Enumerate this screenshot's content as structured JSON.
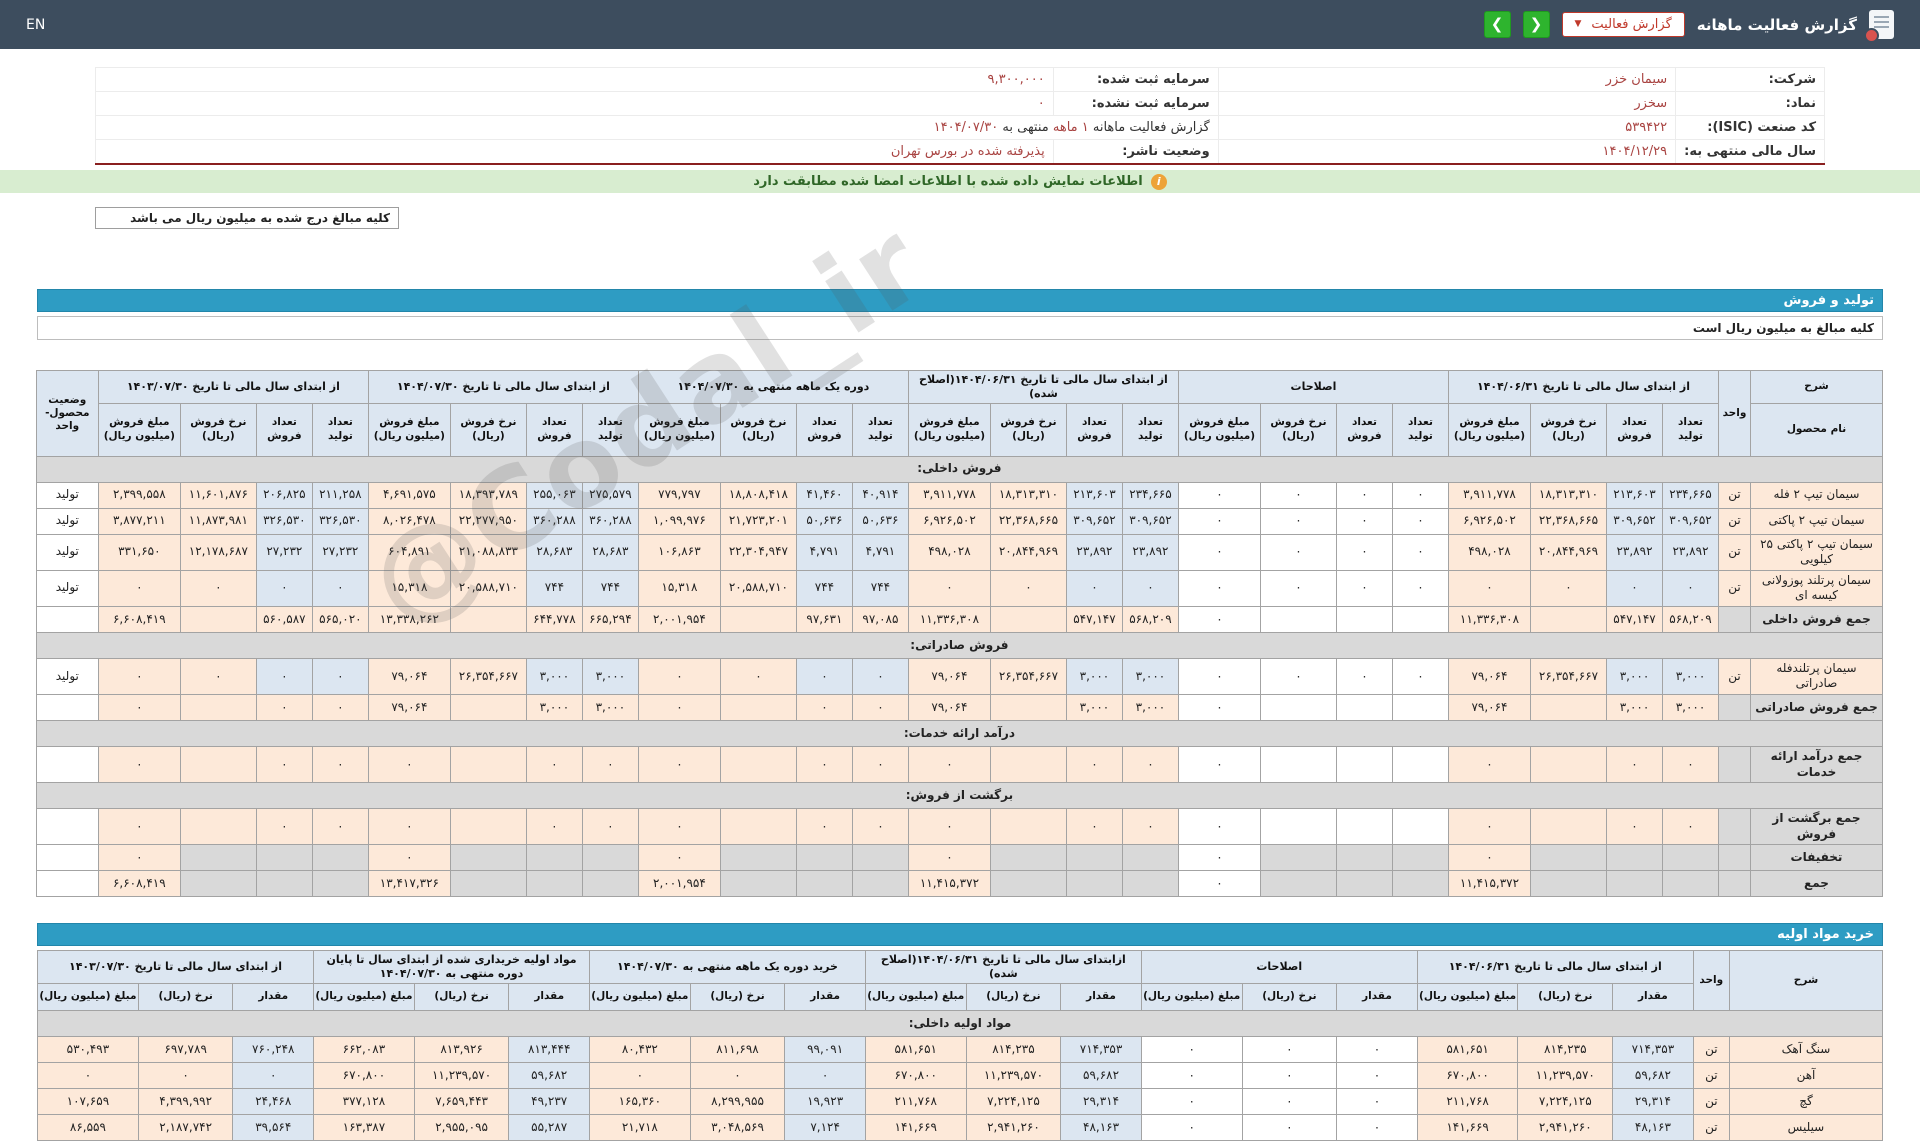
{
  "topbar": {
    "en_link": "EN",
    "title": "گزارش فعالیت ماهانه",
    "report_dropdown": "گزارش فعالیت",
    "caret": "▼",
    "prev_arrow": "❮",
    "next_arrow": "❯"
  },
  "banner": {
    "text": "اطلاعات نمایش داده شده با اطلاعات امضا شده مطابقت دارد",
    "icon": "info-icon"
  },
  "notes": {
    "box": "کلیه مبالغ درج شده به میلیون ریال می باشد",
    "row": "کلیه مبالغ به میلیون ریال است"
  },
  "sections": {
    "sales": "تولید و فروش",
    "materials": "خرید مواد اولیه"
  },
  "watermark": {
    "text": "@Codal_ir"
  },
  "colors": {
    "topbar": "#3d4d5e",
    "section_bar": "#2e9cc3",
    "accent_red": "#a94442",
    "green_button": "#2eb42e",
    "banner_bg": "#d8edd0",
    "header_cell": "#dce6f1",
    "input_cell": "#fde9d9",
    "calc_cell": "#dce6f1",
    "disabled_cell": "#d9d9d9"
  },
  "info": {
    "rows": [
      [
        {
          "segs": [
            {
              "t": "شرکت:"
            }
          ],
          "cls": "il",
          "name": "company-label"
        },
        {
          "segs": [
            {
              "t": "سیمان خزر",
              "r": 1
            }
          ],
          "name": "company-value",
          "link": true
        },
        {
          "segs": [
            {
              "t": "سرمایه ثبت شده:"
            }
          ],
          "cls": "il2",
          "name": "registered-capital-label"
        },
        {
          "segs": [
            {
              "t": "۹,۳۰۰,۰۰۰",
              "r": 1
            }
          ],
          "name": "registered-capital-value"
        }
      ],
      [
        {
          "segs": [
            {
              "t": "نماد:"
            }
          ],
          "cls": "il",
          "name": "symbol-label"
        },
        {
          "segs": [
            {
              "t": "سخزر",
              "r": 1
            }
          ],
          "name": "symbol-value",
          "link": true
        },
        {
          "segs": [
            {
              "t": "سرمایه ثبت نشده:"
            }
          ],
          "cls": "il2",
          "name": "unregistered-capital-label"
        },
        {
          "segs": [
            {
              "t": "۰",
              "r": 1
            }
          ],
          "name": "unregistered-capital-value"
        }
      ],
      [
        {
          "segs": [
            {
              "t": "کد صنعت (ISIC):"
            }
          ],
          "cls": "il",
          "name": "isic-label"
        },
        {
          "segs": [
            {
              "t": "۵۳۹۴۲۲",
              "r": 1
            }
          ],
          "name": "isic-value"
        },
        {
          "segs": [
            {
              "t": "گزارش فعالیت ماهانه "
            },
            {
              "t": "۱ ماهه",
              "r": 1
            },
            {
              "t": " منتهی به "
            },
            {
              "t": "۱۴۰۴/۰۷/۳۰",
              "r": 1
            }
          ],
          "colspan": 2,
          "name": "report-period"
        }
      ],
      [
        {
          "segs": [
            {
              "t": "سال مالی منتهی به:"
            }
          ],
          "cls": "il",
          "name": "fiscal-year-label"
        },
        {
          "segs": [
            {
              "t": "۱۴۰۴/۱۲/۲۹",
              "r": 1
            }
          ],
          "name": "fiscal-year-value"
        },
        {
          "segs": [
            {
              "t": "وضعیت ناشر:"
            }
          ],
          "cls": "il2",
          "name": "issuer-status-label"
        },
        {
          "segs": [
            {
              "t": "پذیرفته شده در بورس تهران",
              "r": 1
            }
          ],
          "name": "issuer-status-value"
        }
      ]
    ]
  },
  "sales_table": {
    "desc_header": "شرح",
    "name_header": "نام محصول",
    "unit_header": "واحد",
    "status_header": "وضعیت محصول-واحد",
    "groups": [
      "از ابتدای سال مالی تا تاریخ ۱۴۰۴/۰۶/۳۱",
      "اصلاحات",
      "از ابتدای سال مالی تا تاریخ ۱۴۰۴/۰۶/۳۱(اصلاح شده)",
      "دوره یک ماهه منتهی به ۱۴۰۴/۰۷/۳۰",
      "از ابتدای سال مالی تا تاریخ ۱۴۰۴/۰۷/۳۰",
      "از ابتدای سال مالی تا تاریخ ۱۴۰۳/۰۷/۳۰"
    ],
    "sub_cols": [
      "تعداد تولید",
      "تعداد فروش",
      "نرخ فروش (ریال)",
      "مبلغ فروش (میلیون ریال)"
    ],
    "rows": [
      {
        "type": "section",
        "name": "فروش داخلی:"
      },
      {
        "type": "product",
        "name": "سیمان تیپ ۲ فله",
        "unit": "تن",
        "status": "تولید",
        "v": [
          "۲۳۴,۶۶۵",
          "۲۱۳,۶۰۳",
          "۱۸,۳۱۳,۳۱۰",
          "۳,۹۱۱,۷۷۸",
          "۰",
          "۰",
          "۰",
          "۰",
          "۲۳۴,۶۶۵",
          "۲۱۳,۶۰۳",
          "۱۸,۳۱۳,۳۱۰",
          "۳,۹۱۱,۷۷۸",
          "۴۰,۹۱۴",
          "۴۱,۴۶۰",
          "۱۸,۸۰۸,۴۱۸",
          "۷۷۹,۷۹۷",
          "۲۷۵,۵۷۹",
          "۲۵۵,۰۶۳",
          "۱۸,۳۹۳,۷۸۹",
          "۴,۶۹۱,۵۷۵",
          "۲۱۱,۲۵۸",
          "۲۰۶,۸۲۵",
          "۱۱,۶۰۱,۸۷۶",
          "۲,۳۹۹,۵۵۸"
        ]
      },
      {
        "type": "product",
        "name": "سیمان تیپ ۲ پاکتی",
        "unit": "تن",
        "status": "تولید",
        "v": [
          "۳۰۹,۶۵۲",
          "۳۰۹,۶۵۲",
          "۲۲,۳۶۸,۶۶۵",
          "۶,۹۲۶,۵۰۲",
          "۰",
          "۰",
          "۰",
          "۰",
          "۳۰۹,۶۵۲",
          "۳۰۹,۶۵۲",
          "۲۲,۳۶۸,۶۶۵",
          "۶,۹۲۶,۵۰۲",
          "۵۰,۶۳۶",
          "۵۰,۶۳۶",
          "۲۱,۷۲۳,۲۰۱",
          "۱,۰۹۹,۹۷۶",
          "۳۶۰,۲۸۸",
          "۳۶۰,۲۸۸",
          "۲۲,۲۷۷,۹۵۰",
          "۸,۰۲۶,۴۷۸",
          "۳۲۶,۵۳۰",
          "۳۲۶,۵۳۰",
          "۱۱,۸۷۳,۹۸۱",
          "۳,۸۷۷,۲۱۱"
        ]
      },
      {
        "type": "product",
        "name": "سیمان تیپ ۲ پاکتی ۲۵ کیلویی",
        "unit": "تن",
        "status": "تولید",
        "v": [
          "۲۳,۸۹۲",
          "۲۳,۸۹۲",
          "۲۰,۸۴۴,۹۶۹",
          "۴۹۸,۰۲۸",
          "۰",
          "۰",
          "۰",
          "۰",
          "۲۳,۸۹۲",
          "۲۳,۸۹۲",
          "۲۰,۸۴۴,۹۶۹",
          "۴۹۸,۰۲۸",
          "۴,۷۹۱",
          "۴,۷۹۱",
          "۲۲,۳۰۴,۹۴۷",
          "۱۰۶,۸۶۳",
          "۲۸,۶۸۳",
          "۲۸,۶۸۳",
          "۲۱,۰۸۸,۸۳۳",
          "۶۰۴,۸۹۱",
          "۲۷,۲۳۲",
          "۲۷,۲۳۲",
          "۱۲,۱۷۸,۶۸۷",
          "۳۳۱,۶۵۰"
        ]
      },
      {
        "type": "product",
        "name": "سیمان پرتلند پوزولانی کیسه ای",
        "unit": "تن",
        "status": "تولید",
        "v": [
          "۰",
          "۰",
          "۰",
          "۰",
          "۰",
          "۰",
          "۰",
          "۰",
          "۰",
          "۰",
          "۰",
          "۰",
          "۷۴۴",
          "۷۴۴",
          "۲۰,۵۸۸,۷۱۰",
          "۱۵,۳۱۸",
          "۷۴۴",
          "۷۴۴",
          "۲۰,۵۸۸,۷۱۰",
          "۱۵,۳۱۸",
          "۰",
          "۰",
          "۰",
          "۰"
        ]
      },
      {
        "type": "total",
        "name": "جمع فروش داخلی",
        "unit": "",
        "v": [
          "۵۶۸,۲۰۹",
          "۵۴۷,۱۴۷",
          "",
          "۱۱,۳۳۶,۳۰۸",
          "",
          "",
          "",
          "۰",
          "۵۶۸,۲۰۹",
          "۵۴۷,۱۴۷",
          "",
          "۱۱,۳۳۶,۳۰۸",
          "۹۷,۰۸۵",
          "۹۷,۶۳۱",
          "",
          "۲,۰۰۱,۹۵۴",
          "۶۶۵,۲۹۴",
          "۶۴۴,۷۷۸",
          "",
          "۱۳,۳۳۸,۲۶۲",
          "۵۶۵,۰۲۰",
          "۵۶۰,۵۸۷",
          "",
          "۶,۶۰۸,۴۱۹"
        ]
      },
      {
        "type": "section",
        "name": "فروش صادراتی:"
      },
      {
        "type": "product",
        "name": "سیمان پرتلندفله صادراتی",
        "unit": "تن",
        "status": "تولید",
        "v": [
          "۳,۰۰۰",
          "۳,۰۰۰",
          "۲۶,۳۵۴,۶۶۷",
          "۷۹,۰۶۴",
          "۰",
          "۰",
          "۰",
          "۰",
          "۳,۰۰۰",
          "۳,۰۰۰",
          "۲۶,۳۵۴,۶۶۷",
          "۷۹,۰۶۴",
          "۰",
          "۰",
          "۰",
          "۰",
          "۳,۰۰۰",
          "۳,۰۰۰",
          "۲۶,۳۵۴,۶۶۷",
          "۷۹,۰۶۴",
          "۰",
          "۰",
          "۰",
          "۰"
        ]
      },
      {
        "type": "total",
        "name": "جمع فروش صادراتی",
        "unit": "",
        "v": [
          "۳,۰۰۰",
          "۳,۰۰۰",
          "",
          "۷۹,۰۶۴",
          "",
          "",
          "",
          "۰",
          "۳,۰۰۰",
          "۳,۰۰۰",
          "",
          "۷۹,۰۶۴",
          "۰",
          "۰",
          "",
          "۰",
          "۳,۰۰۰",
          "۳,۰۰۰",
          "",
          "۷۹,۰۶۴",
          "۰",
          "۰",
          "",
          "۰"
        ]
      },
      {
        "type": "section",
        "name": "درآمد ارائه خدمات:"
      },
      {
        "type": "total",
        "name": "جمع درآمد ارائه خدمات",
        "unit": "",
        "v": [
          "۰",
          "۰",
          "",
          "۰",
          "",
          "",
          "",
          "۰",
          "۰",
          "۰",
          "",
          "۰",
          "۰",
          "۰",
          "",
          "۰",
          "۰",
          "۰",
          "",
          "۰",
          "۰",
          "۰",
          "",
          "۰"
        ]
      },
      {
        "type": "section",
        "name": "برگشت از فروش:"
      },
      {
        "type": "total",
        "name": "جمع برگشت از فروش",
        "unit": "",
        "v": [
          "۰",
          "۰",
          "",
          "۰",
          "",
          "",
          "",
          "۰",
          "۰",
          "۰",
          "",
          "۰",
          "۰",
          "۰",
          "",
          "۰",
          "۰",
          "۰",
          "",
          "۰",
          "۰",
          "۰",
          "",
          "۰"
        ]
      },
      {
        "type": "discount",
        "name": "تخفیفات",
        "unit": "",
        "v": [
          "",
          "",
          "",
          "۰",
          "",
          "",
          "",
          "۰",
          "",
          "",
          "",
          "۰",
          "",
          "",
          "",
          "۰",
          "",
          "",
          "",
          "۰",
          "",
          "",
          "",
          "۰"
        ]
      },
      {
        "type": "grand",
        "name": "جمع",
        "unit": "",
        "v": [
          "",
          "",
          "",
          "۱۱,۴۱۵,۳۷۲",
          "",
          "",
          "",
          "۰",
          "",
          "",
          "",
          "۱۱,۴۱۵,۳۷۲",
          "",
          "",
          "",
          "۲,۰۰۱,۹۵۴",
          "",
          "",
          "",
          "۱۳,۴۱۷,۳۲۶",
          "",
          "",
          "",
          "۶,۶۰۸,۴۱۹"
        ]
      }
    ]
  },
  "purchase_table": {
    "desc_header": "شرح",
    "unit_header": "واحد",
    "groups": [
      "از ابتدای سال مالی تا تاریخ ۱۴۰۴/۰۶/۳۱",
      "اصلاحات",
      "ازابتدای سال مالی تا تاریخ ۱۴۰۴/۰۶/۳۱(اصلاح شده)",
      "خرید دوره یک ماهه منتهی به ۱۴۰۴/۰۷/۳۰",
      "مواد اولیه خریداری شده از ابتدای سال تا پایان دوره منتهی به ۱۴۰۴/۰۷/۳۰",
      "از ابتدای سال مالی تا تاریخ ۱۴۰۳/۰۷/۳۰"
    ],
    "sub_cols": [
      "مقدار",
      "نرخ (ریال)",
      "مبلغ (میلیون ریال)"
    ],
    "rows": [
      {
        "type": "section",
        "name": "مواد اولیه داخلی:"
      },
      {
        "type": "product",
        "name": "سنگ آهک",
        "unit": "تن",
        "v": [
          "۷۱۴,۳۵۳",
          "۸۱۴,۲۳۵",
          "۵۸۱,۶۵۱",
          "۰",
          "۰",
          "۰",
          "۷۱۴,۳۵۳",
          "۸۱۴,۲۳۵",
          "۵۸۱,۶۵۱",
          "۹۹,۰۹۱",
          "۸۱۱,۶۹۸",
          "۸۰,۴۳۲",
          "۸۱۳,۴۴۴",
          "۸۱۳,۹۲۶",
          "۶۶۲,۰۸۳",
          "۷۶۰,۲۴۸",
          "۶۹۷,۷۸۹",
          "۵۳۰,۴۹۳"
        ]
      },
      {
        "type": "product",
        "name": "آهن",
        "unit": "تن",
        "v": [
          "۵۹,۶۸۲",
          "۱۱,۲۳۹,۵۷۰",
          "۶۷۰,۸۰۰",
          "۰",
          "۰",
          "۰",
          "۵۹,۶۸۲",
          "۱۱,۲۳۹,۵۷۰",
          "۶۷۰,۸۰۰",
          "۰",
          "۰",
          "۰",
          "۵۹,۶۸۲",
          "۱۱,۲۳۹,۵۷۰",
          "۶۷۰,۸۰۰",
          "۰",
          "۰",
          "۰"
        ]
      },
      {
        "type": "product",
        "name": "گچ",
        "unit": "تن",
        "v": [
          "۲۹,۳۱۴",
          "۷,۲۲۴,۱۲۵",
          "۲۱۱,۷۶۸",
          "۰",
          "۰",
          "۰",
          "۲۹,۳۱۴",
          "۷,۲۲۴,۱۲۵",
          "۲۱۱,۷۶۸",
          "۱۹,۹۲۳",
          "۸,۲۹۹,۹۵۵",
          "۱۶۵,۳۶۰",
          "۴۹,۲۳۷",
          "۷,۶۵۹,۴۴۳",
          "۳۷۷,۱۲۸",
          "۲۴,۴۶۸",
          "۴,۳۹۹,۹۹۲",
          "۱۰۷,۶۵۹"
        ]
      },
      {
        "type": "product",
        "name": "سیلیس",
        "unit": "تن",
        "v": [
          "۴۸,۱۶۳",
          "۲,۹۴۱,۲۶۰",
          "۱۴۱,۶۶۹",
          "۰",
          "۰",
          "۰",
          "۴۸,۱۶۳",
          "۲,۹۴۱,۲۶۰",
          "۱۴۱,۶۶۹",
          "۷,۱۲۴",
          "۳,۰۴۸,۵۶۹",
          "۲۱,۷۱۸",
          "۵۵,۲۸۷",
          "۲,۹۵۵,۰۹۵",
          "۱۶۳,۳۸۷",
          "۳۹,۵۶۴",
          "۲,۱۸۷,۷۴۲",
          "۸۶,۵۵۹"
        ]
      }
    ]
  }
}
